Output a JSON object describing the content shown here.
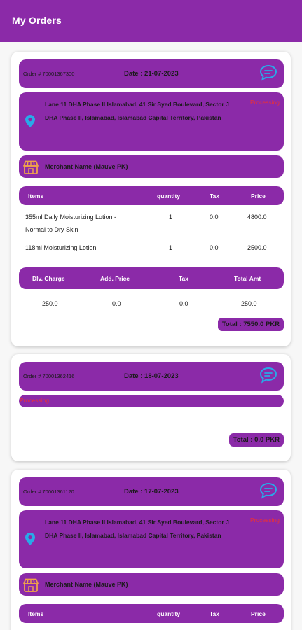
{
  "app": {
    "title": "My Orders"
  },
  "colors": {
    "primary": "#8b2aa8",
    "status": "#e8303a",
    "icon": "#29a9e8",
    "shop_icon": "#f0a34a"
  },
  "icons": {
    "chat": "chat-bubble-icon",
    "location": "location-pin-icon",
    "shop": "shop-icon"
  },
  "orders": [
    {
      "order_no": "Order # 70001367300",
      "date": "Date : 21-07-2023",
      "status": "Processing",
      "address": "Lane 11 DHA Phase II Islamabad, 41 Sir Syed Boulevard, Sector J DHA Phase II, Islamabad, Islamabad Capital Territory, Pakistan",
      "merchant": "Merchant Name (Mauve PK)",
      "items_header": {
        "items": "Items",
        "quantity": "quantity",
        "tax": "Tax",
        "price": "Price"
      },
      "items": [
        {
          "name_line1": "355ml Daily Moisturizing Lotion -",
          "name_line2": "Normal to Dry Skin",
          "quantity": "1",
          "tax": "0.0",
          "price": "4800.0"
        },
        {
          "name_line1": "118ml Moisturizing Lotion",
          "name_line2": "",
          "quantity": "1",
          "tax": "0.0",
          "price": "2500.0"
        }
      ],
      "charges_header": {
        "delivery": "Dlv. Charge",
        "add_price": "Add. Price",
        "tax": "Tax",
        "total_amt": "Total Amt"
      },
      "charges": {
        "delivery": "250.0",
        "add_price": "0.0",
        "tax": "0.0",
        "total_amt": "250.0"
      },
      "total": "Total : 7550.0 PKR"
    },
    {
      "order_no": "Order # 70001362416",
      "date": "Date : 18-07-2023",
      "status": "Processing",
      "total": "Total : 0.0 PKR"
    },
    {
      "order_no": "Order # 70001361120",
      "date": "Date : 17-07-2023",
      "status": "Processing",
      "address": "Lane 11 DHA Phase II Islamabad, 41 Sir Syed Boulevard, Sector J DHA Phase II, Islamabad, Islamabad Capital Territory, Pakistan",
      "merchant": "Merchant Name (Mauve PK)",
      "items_header": {
        "items": "Items",
        "quantity": "quantity",
        "tax": "Tax",
        "price": "Price"
      }
    }
  ]
}
